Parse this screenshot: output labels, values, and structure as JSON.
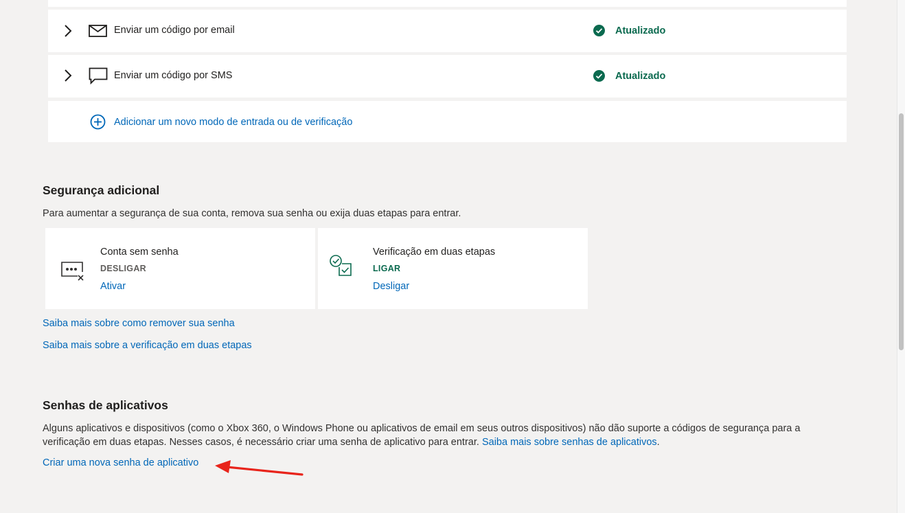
{
  "methods": [
    {
      "label": "Enviar um código por email",
      "icon": "mail-icon",
      "status": "Atualizado"
    },
    {
      "label": "Enviar um código por SMS",
      "icon": "chat-icon",
      "status": "Atualizado"
    }
  ],
  "add_method_label": "Adicionar um novo modo de entrada ou de verificação",
  "additional_security": {
    "title": "Segurança adicional",
    "description": "Para aumentar a segurança de sua conta, remova sua senha ou exija duas etapas para entrar.",
    "cards": [
      {
        "title": "Conta sem senha",
        "state": "DESLIGAR",
        "action": "Ativar",
        "icon": "passwordless-icon",
        "state_color": "#605e5c"
      },
      {
        "title": "Verificação em duas etapas",
        "state": "LIGAR",
        "action": "Desligar",
        "icon": "two-step-icon",
        "state_color": "#0b6a4f"
      }
    ],
    "link_remove_password": "Saiba mais sobre como remover sua senha",
    "link_two_step": "Saiba mais sobre a verificação em duas etapas"
  },
  "app_passwords": {
    "title": "Senhas de aplicativos",
    "description_line1": "Alguns aplicativos e dispositivos (como o Xbox 360, o Windows Phone ou aplicativos de email em seus outros dispositivos) não dão suporte a códigos de segurança para a",
    "description_line2": "verificação em duas etapas. Nesses casos, é necessário criar uma senha de aplicativo para entrar.",
    "learn_more": "Saiba mais sobre senhas de aplicativos",
    "create_link": "Criar uma nova senha de aplicativo"
  },
  "colors": {
    "link": "#0067b8",
    "success": "#0b6a4f",
    "annotation_arrow": "#e8241b"
  }
}
